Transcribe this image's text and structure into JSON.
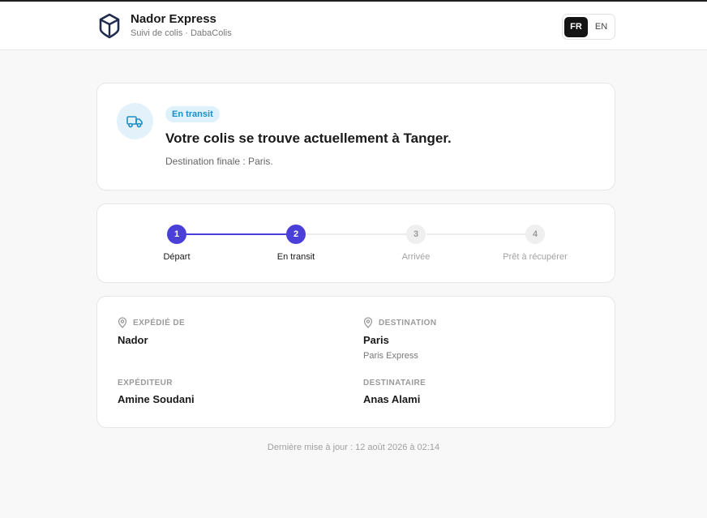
{
  "header": {
    "title": "Nador Express",
    "subtitle": "Suivi de colis · DabaColis",
    "lang": {
      "fr": "FR",
      "en": "EN",
      "active": "FR"
    }
  },
  "status": {
    "badge": "En transit",
    "message": "Votre colis se trouve actuellement à Tanger.",
    "sub": "Destination finale : Paris.",
    "accent": "#4b3fd9",
    "badge_color": "#1a8fc7"
  },
  "steps": [
    {
      "num": "1",
      "label": "Départ",
      "done": true
    },
    {
      "num": "2",
      "label": "En transit",
      "done": true
    },
    {
      "num": "3",
      "label": "Arrivée",
      "done": false
    },
    {
      "num": "4",
      "label": "Prêt à récupérer",
      "done": false
    }
  ],
  "info": {
    "origin_label": "EXPÉDIÉ DE",
    "origin_value": "Nador",
    "dest_label": "DESTINATION",
    "dest_value": "Paris",
    "dest_sub": "Paris Express",
    "sender_label": "EXPÉDITEUR",
    "sender_value": "Amine Soudani",
    "recipient_label": "DESTINATAIRE",
    "recipient_value": "Anas Alami"
  },
  "footer": {
    "updated": "Dernière mise à jour : 12 août 2026 à 02:14"
  },
  "icons": {
    "logo": "package-cube-icon",
    "status": "truck-icon",
    "location": "map-pin-icon"
  }
}
